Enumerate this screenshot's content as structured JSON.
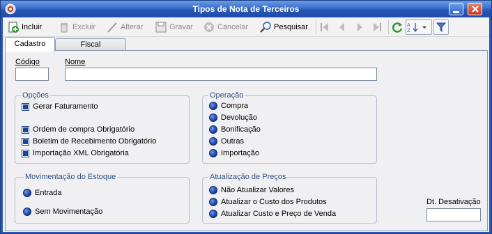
{
  "window": {
    "title": "Tipos de Nota de Terceiros"
  },
  "toolbar": {
    "incluir": "Incluir",
    "excluir": "Excluir",
    "alterar": "Alterar",
    "gravar": "Gravar",
    "cancelar": "Cancelar",
    "pesquisar": "Pesquisar"
  },
  "tabs": [
    {
      "label": "Cadastro",
      "active": true
    },
    {
      "label": "Fiscal",
      "active": false
    }
  ],
  "form": {
    "codigo_label": "Código",
    "codigo_value": "",
    "nome_label": "Nome",
    "nome_value": "",
    "dt_desativacao_label": "Dt. Desativação",
    "dt_desativacao_value": ""
  },
  "opcoes": {
    "title": "Opções",
    "items": [
      {
        "label": "Gerar Faturamento",
        "checked": true
      },
      {
        "label": "Ordem de compra Obrigatório",
        "checked": true
      },
      {
        "label": "Boletim de Recebimento Obrigatório",
        "checked": true
      },
      {
        "label": "Importação XML Obrigatória",
        "checked": true
      }
    ]
  },
  "operacao": {
    "title": "Operação",
    "items": [
      "Compra",
      "Devolução",
      "Bonificação",
      "Outras",
      "Importação"
    ]
  },
  "movimentacao": {
    "title": "Movimentação do Estoque",
    "items": [
      "Entrada",
      "Sem Movimentação"
    ]
  },
  "atualizacao": {
    "title": "Atualização de Preços",
    "items": [
      "Não Atualizar Valores",
      "Atualizar o Custo dos Produtos",
      "Atualizar Custo e Preço de Venda"
    ]
  },
  "colors": {
    "titlebar": "#2658b8",
    "group_title": "#2e4f84",
    "accent": "#1d46a6"
  }
}
